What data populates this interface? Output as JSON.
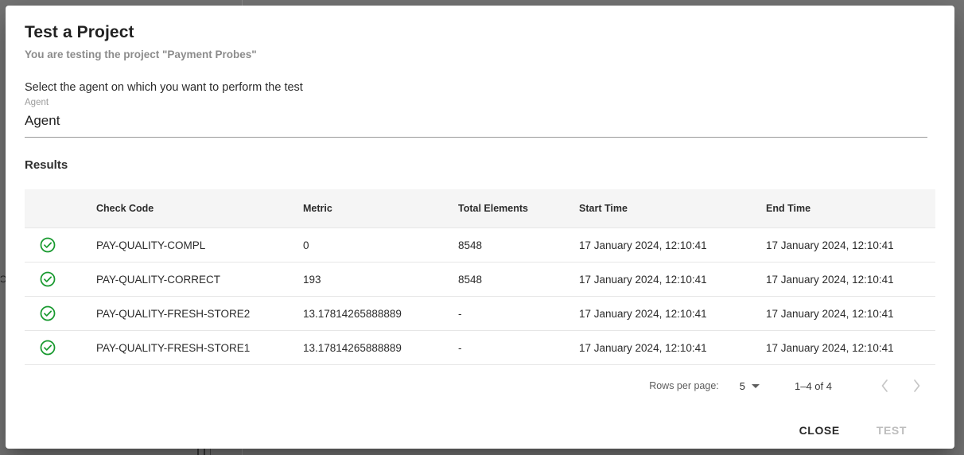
{
  "dialog": {
    "title": "Test a Project",
    "subtitle": "You are testing the project \"Payment Probes\"",
    "select_prompt": "Select the agent on which you want to perform the test",
    "agent_field": {
      "label": "Agent",
      "value": "Agent"
    },
    "results_heading": "Results",
    "table": {
      "columns": [
        "",
        "Check Code",
        "Metric",
        "Total Elements",
        "Start Time",
        "End Time"
      ],
      "rows": [
        {
          "status": "check-circle",
          "check_code": "PAY-QUALITY-COMPL",
          "metric": "0",
          "total_elements": "8548",
          "start_time": "17 January 2024, 12:10:41",
          "end_time": "17 January 2024, 12:10:41"
        },
        {
          "status": "check-circle",
          "check_code": "PAY-QUALITY-CORRECT",
          "metric": "193",
          "total_elements": "8548",
          "start_time": "17 January 2024, 12:10:41",
          "end_time": "17 January 2024, 12:10:41"
        },
        {
          "status": "check-circle",
          "check_code": "PAY-QUALITY-FRESH-STORE2",
          "metric": "13.17814265888889",
          "total_elements": "-",
          "start_time": "17 January 2024, 12:10:41",
          "end_time": "17 January 2024, 12:10:41"
        },
        {
          "status": "check-circle",
          "check_code": "PAY-QUALITY-FRESH-STORE1",
          "metric": "13.17814265888889",
          "total_elements": "-",
          "start_time": "17 January 2024, 12:10:41",
          "end_time": "17 January 2024, 12:10:41"
        }
      ]
    },
    "paginator": {
      "rows_per_page_label": "Rows per page:",
      "rows_per_page_value": "5",
      "range_label": "1–4 of 4",
      "prev_icon": "chevron-left-icon",
      "next_icon": "chevron-right-icon"
    },
    "actions": {
      "close_label": "CLOSE",
      "test_label": "TEST"
    }
  },
  "colors": {
    "success_green": "#17992e",
    "backdrop": "#757575",
    "header_row": "#f5f5f5",
    "divider": "#e6e6e6",
    "disabled_text": "#bdbdbd"
  }
}
